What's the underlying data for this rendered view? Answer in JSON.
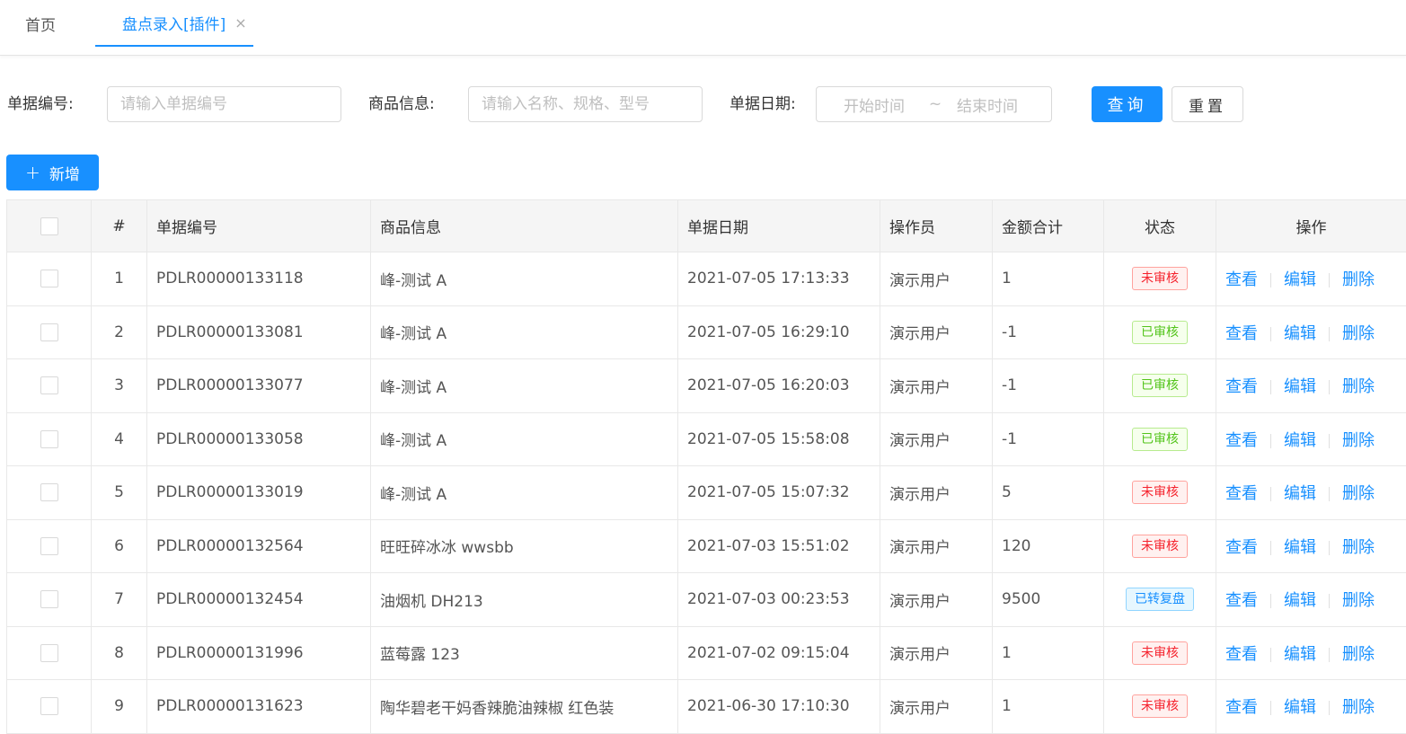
{
  "tabs": [
    {
      "label": "首页"
    },
    {
      "label": "盘点录入[插件]",
      "close": "×"
    }
  ],
  "search": {
    "doc_no_label": "单据编号:",
    "doc_no_placeholder": "请输入单据编号",
    "goods_label": "商品信息:",
    "goods_placeholder": "请输入名称、规格、型号",
    "date_label": "单据日期:",
    "date_start_placeholder": "开始时间",
    "date_sep": "~",
    "date_end_placeholder": "结束时间",
    "query_label": "查询",
    "reset_label": "重置"
  },
  "toolbar": {
    "add_plus": "+",
    "add_label": "新增"
  },
  "table": {
    "headers": [
      "#",
      "单据编号",
      "商品信息",
      "单据日期",
      "操作员",
      "金额合计",
      "状态",
      "操作"
    ],
    "actions": [
      "查看",
      "编辑",
      "删除"
    ],
    "rows": [
      {
        "idx": "1",
        "no": "PDLR00000133118",
        "goods": "峰-测试 A",
        "date": "2021-07-05 17:13:33",
        "operator": "演示用户",
        "amount": "1",
        "status": "未审核",
        "status_color": "red"
      },
      {
        "idx": "2",
        "no": "PDLR00000133081",
        "goods": "峰-测试 A",
        "date": "2021-07-05 16:29:10",
        "operator": "演示用户",
        "amount": "-1",
        "status": "已审核",
        "status_color": "green"
      },
      {
        "idx": "3",
        "no": "PDLR00000133077",
        "goods": "峰-测试 A",
        "date": "2021-07-05 16:20:03",
        "operator": "演示用户",
        "amount": "-1",
        "status": "已审核",
        "status_color": "green"
      },
      {
        "idx": "4",
        "no": "PDLR00000133058",
        "goods": "峰-测试 A",
        "date": "2021-07-05 15:58:08",
        "operator": "演示用户",
        "amount": "-1",
        "status": "已审核",
        "status_color": "green"
      },
      {
        "idx": "5",
        "no": "PDLR00000133019",
        "goods": "峰-测试 A",
        "date": "2021-07-05 15:07:32",
        "operator": "演示用户",
        "amount": "5",
        "status": "未审核",
        "status_color": "red"
      },
      {
        "idx": "6",
        "no": "PDLR00000132564",
        "goods": "旺旺碎冰冰 wwsbb",
        "date": "2021-07-03 15:51:02",
        "operator": "演示用户",
        "amount": "120",
        "status": "未审核",
        "status_color": "red"
      },
      {
        "idx": "7",
        "no": "PDLR00000132454",
        "goods": "油烟机 DH213",
        "date": "2021-07-03 00:23:53",
        "operator": "演示用户",
        "amount": "9500",
        "status": "已转复盘",
        "status_color": "blue"
      },
      {
        "idx": "8",
        "no": "PDLR00000131996",
        "goods": "蓝莓露 123",
        "date": "2021-07-02 09:15:04",
        "operator": "演示用户",
        "amount": "1",
        "status": "未审核",
        "status_color": "red"
      },
      {
        "idx": "9",
        "no": "PDLR00000131623",
        "goods": "陶华碧老干妈香辣脆油辣椒 红色装",
        "date": "2021-06-30 17:10:30",
        "operator": "演示用户",
        "amount": "1",
        "status": "未审核",
        "status_color": "red"
      }
    ]
  }
}
